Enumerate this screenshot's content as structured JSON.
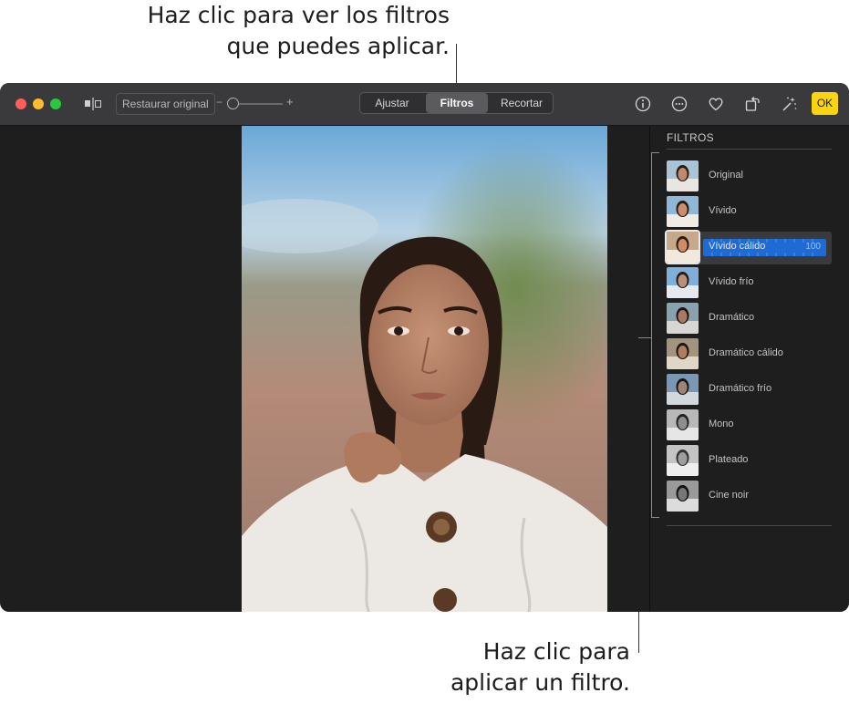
{
  "callouts": {
    "top_line1": "Haz clic para ver los filtros",
    "top_line2": "que puedes aplicar.",
    "bottom_line1": "Haz clic para",
    "bottom_line2": "aplicar un filtro."
  },
  "toolbar": {
    "restore_label": "Restaurar original",
    "zoom_minus": "−",
    "zoom_plus": "+",
    "tabs": [
      "Ajustar",
      "Filtros",
      "Recortar"
    ],
    "active_tab": "Filtros",
    "ok_label": "OK",
    "icons": [
      "compare-icon",
      "info-icon",
      "more-icon",
      "heart-icon",
      "rotate-icon",
      "magic-wand-icon"
    ]
  },
  "sidebar": {
    "title": "FILTROS",
    "filters": [
      "Original",
      "Vívido",
      "Vívido cálido",
      "Vívido frío",
      "Dramático",
      "Dramático cálido",
      "Dramático frío",
      "Mono",
      "Plateado",
      "Cine noir"
    ],
    "selected": "Vívido cálido",
    "selected_intensity": "100"
  },
  "colors": {
    "accent": "#1f6bd6",
    "ok_button": "#f9d40f",
    "toolbar": "#3a3a3c",
    "window_bg": "#1e1e1e"
  }
}
